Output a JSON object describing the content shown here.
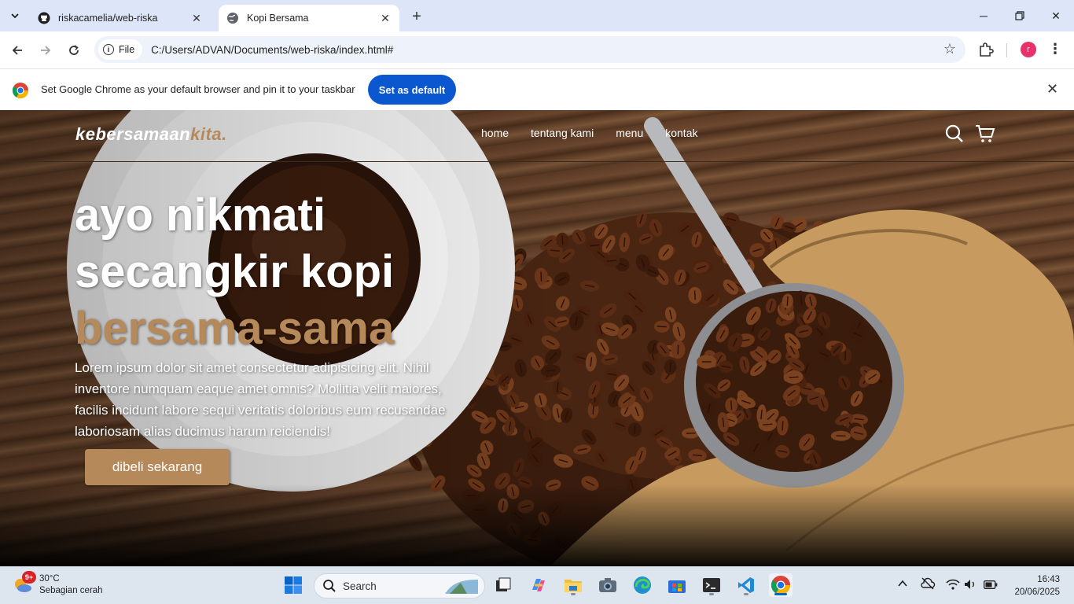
{
  "browser": {
    "tabs": [
      {
        "title": "riskacamelia/web-riska",
        "favicon": "github-icon"
      },
      {
        "title": "Kopi Bersama",
        "favicon": "globe-icon"
      }
    ],
    "url_chip": "File",
    "url": "C:/Users/ADVAN/Documents/web-riska/index.html#",
    "profile_initial": "r"
  },
  "infobar": {
    "message": "Set Google Chrome as your default browser and pin it to your taskbar",
    "button": "Set as default"
  },
  "site": {
    "logo_main": "kebersamaan",
    "logo_accent": "kita",
    "logo_dot": ".",
    "nav": [
      "home",
      "tentang kami",
      "menu",
      "kontak"
    ],
    "hero_line1": "ayo nikmati",
    "hero_line2": "secangkir kopi",
    "hero_line3": "bersama-sama",
    "hero_text": "Lorem ipsum dolor sit amet consectetur adipisicing elit. Nihil inventore numquam eaque amet omnis? Mollitia velit maiores, facilis incidunt labore sequi veritatis doloribus eum recusandae laboriosam alias ducimus harum reiciendis!",
    "cta": "dibeli sekarang",
    "accent_color": "#b6895b"
  },
  "taskbar": {
    "weather_temp": "30°C",
    "weather_desc": "Sebagian cerah",
    "weather_badge": "9+",
    "search_placeholder": "Search",
    "time": "16:43",
    "date": "20/06/2025"
  }
}
